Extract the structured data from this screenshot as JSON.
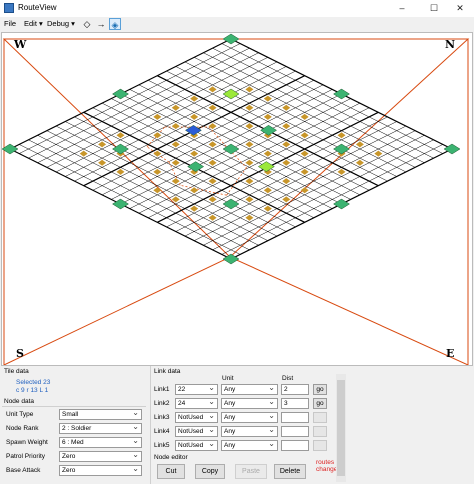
{
  "window": {
    "title": "RouteView",
    "minimize": "–",
    "maximize": "☐",
    "close": "✕"
  },
  "menu": {
    "file": "File",
    "edit": "Edit ▾",
    "debug": "Debug ▾"
  },
  "toolbar": {
    "icons": [
      "diamond-icon",
      "arrow-right-icon",
      "target-icon"
    ]
  },
  "compass": {
    "w": "W",
    "n": "N",
    "s": "S",
    "e": "E"
  },
  "colors": {
    "grid": "#000000",
    "route": "#e05a1a",
    "frame": "#d84a10",
    "tile": "#c8962a",
    "node": "#3cb371",
    "node_selected": "#2a5bd7",
    "node_highlight": "#9be83a"
  },
  "tile_data": {
    "label": "Tile data",
    "selected_line": "Selected 23",
    "coords_line": "c 9  r 13  L 1"
  },
  "node_data": {
    "label": "Node data",
    "fields": [
      {
        "label": "Unit Type",
        "value": "Small"
      },
      {
        "label": "Node Rank",
        "value": "2 : Soldier"
      },
      {
        "label": "Spawn Weight",
        "value": "6 : Med"
      },
      {
        "label": "Patrol Priority",
        "value": "Zero"
      },
      {
        "label": "Base Attack",
        "value": "Zero"
      }
    ]
  },
  "link_data": {
    "label": "Link data",
    "unit_header": "Unit",
    "dist_header": "Dist",
    "go_label": "go",
    "rows": [
      {
        "label": "Link1",
        "dest": "22",
        "unit": "Any",
        "dist": "2",
        "go_enabled": true
      },
      {
        "label": "Link2",
        "dest": "24",
        "unit": "Any",
        "dist": "3",
        "go_enabled": true
      },
      {
        "label": "Link3",
        "dest": "NotUsed",
        "unit": "Any",
        "dist": "",
        "go_enabled": false
      },
      {
        "label": "Link4",
        "dest": "NotUsed",
        "unit": "Any",
        "dist": "",
        "go_enabled": false
      },
      {
        "label": "Link5",
        "dest": "NotUsed",
        "unit": "Any",
        "dist": "",
        "go_enabled": false
      }
    ]
  },
  "node_editor": {
    "label": "Node editor",
    "cut": "Cut",
    "copy": "Copy",
    "paste": "Paste",
    "delete": "Delete",
    "status": "routes changed"
  }
}
